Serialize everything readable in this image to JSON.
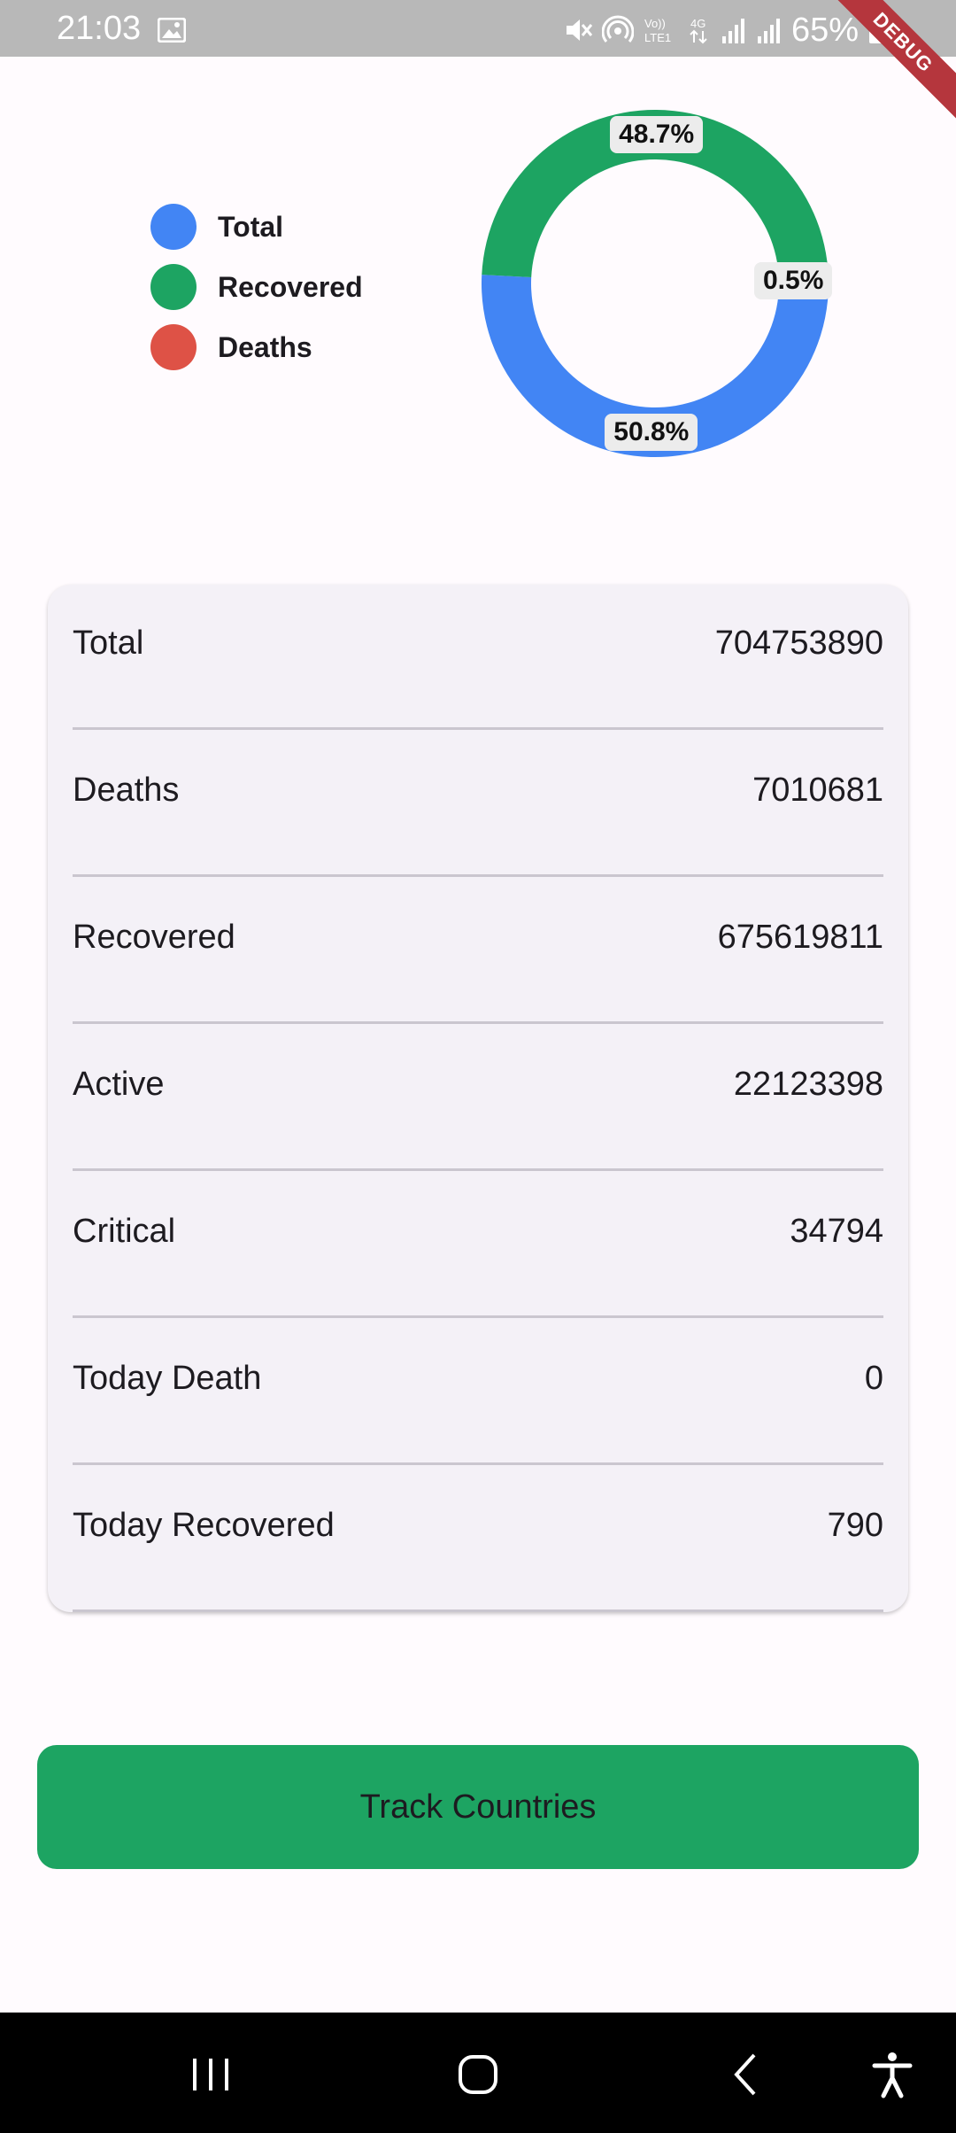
{
  "status_bar": {
    "time": "21:03",
    "battery": "65%",
    "icons": [
      "gallery-icon",
      "mute-icon",
      "hotspot-icon",
      "volte-icon",
      "4g-icon",
      "signal-icon",
      "signal-icon",
      "battery-icon"
    ]
  },
  "debug_banner": "DEBUG",
  "legend": [
    {
      "label": "Total",
      "color": "#4285f4"
    },
    {
      "label": "Recovered",
      "color": "#1da462"
    },
    {
      "label": "Deaths",
      "color": "#de5246"
    }
  ],
  "chart_data": {
    "type": "pie",
    "donut": true,
    "slices": [
      {
        "label": "Total",
        "value": 50.8,
        "display": "50.8%",
        "color": "#4285f4"
      },
      {
        "label": "Recovered",
        "value": 48.7,
        "display": "48.7%",
        "color": "#1da462"
      },
      {
        "label": "Deaths",
        "value": 0.5,
        "display": "0.5%",
        "color": "#de5246"
      }
    ]
  },
  "stats": [
    {
      "label": "Total",
      "value": "704753890"
    },
    {
      "label": "Deaths",
      "value": "7010681"
    },
    {
      "label": "Recovered",
      "value": "675619811"
    },
    {
      "label": "Active",
      "value": "22123398"
    },
    {
      "label": "Critical",
      "value": "34794"
    },
    {
      "label": "Today Death",
      "value": "0"
    },
    {
      "label": "Today Recovered",
      "value": "790"
    }
  ],
  "track_button": {
    "label": "Track Countries",
    "color": "#1da462"
  },
  "nav_bar": {
    "icons": [
      "recent-apps-icon",
      "home-icon",
      "back-icon",
      "accessibility-icon"
    ]
  }
}
